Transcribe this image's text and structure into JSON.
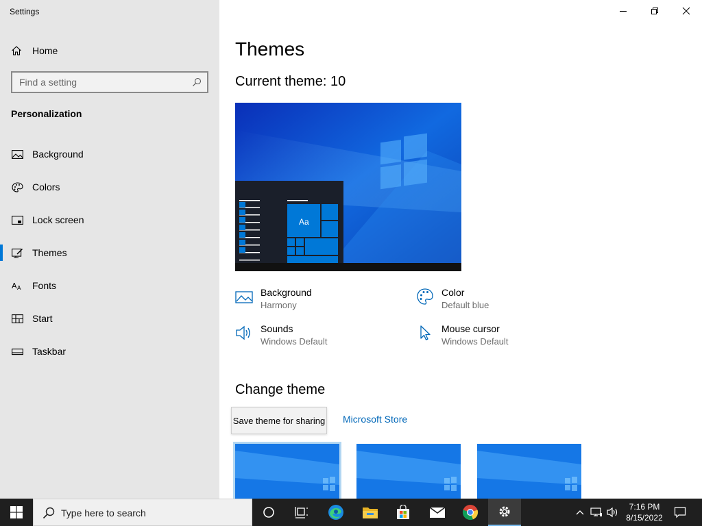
{
  "window": {
    "title": "Settings"
  },
  "sidebar": {
    "home_label": "Home",
    "search_placeholder": "Find a setting",
    "section_title": "Personalization",
    "items": [
      {
        "label": "Background",
        "icon": "picture-icon"
      },
      {
        "label": "Colors",
        "icon": "palette-icon"
      },
      {
        "label": "Lock screen",
        "icon": "lock-screen-icon"
      },
      {
        "label": "Themes",
        "icon": "themes-icon",
        "active": true
      },
      {
        "label": "Fonts",
        "icon": "fonts-icon"
      },
      {
        "label": "Start",
        "icon": "start-icon"
      },
      {
        "label": "Taskbar",
        "icon": "taskbar-icon"
      }
    ]
  },
  "main": {
    "title": "Themes",
    "current_theme": "Current theme: 10",
    "preview_tile_label": "Aa",
    "properties": [
      {
        "title": "Background",
        "value": "Harmony",
        "icon": "picture-icon"
      },
      {
        "title": "Color",
        "value": "Default blue",
        "icon": "palette-icon"
      },
      {
        "title": "Sounds",
        "value": "Windows Default",
        "icon": "speaker-icon"
      },
      {
        "title": "Mouse cursor",
        "value": "Windows Default",
        "icon": "cursor-icon"
      }
    ],
    "change_theme_title": "Change theme",
    "store_link": "Microsoft Store",
    "tooltip": "Save theme for sharing"
  },
  "taskbar": {
    "search_placeholder": "Type here to search",
    "time": "7:16 PM",
    "date": "8/15/2022",
    "apps": [
      "cortana-icon",
      "task-view-icon",
      "edge-icon",
      "file-explorer-icon",
      "store-icon",
      "mail-icon",
      "chrome-icon",
      "settings-icon"
    ]
  },
  "colors": {
    "accent": "#0078d7",
    "link": "#0067b8",
    "sidebar_bg": "#e6e6e6",
    "taskbar_bg": "#1f1f1f"
  }
}
